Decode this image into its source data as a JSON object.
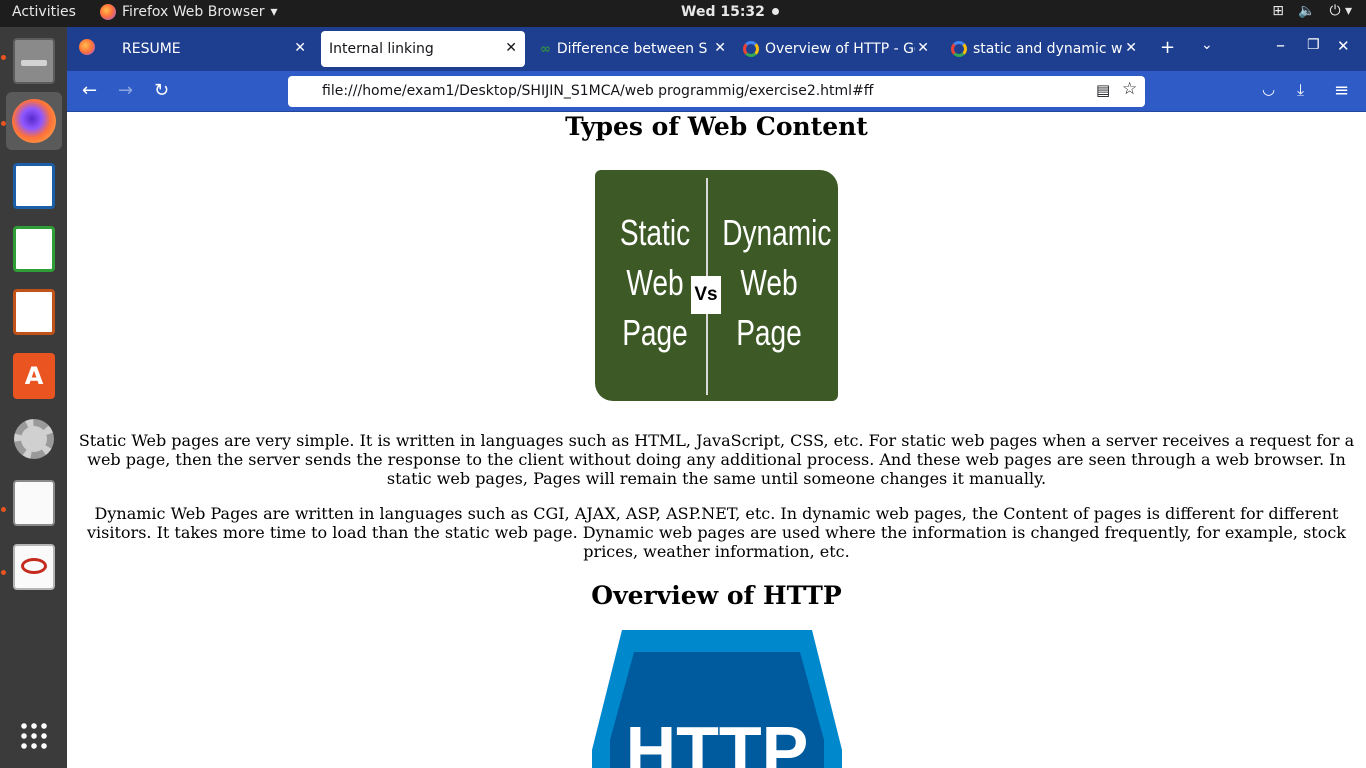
{
  "topbar": {
    "activities": "Activities",
    "app_name": "Firefox Web Browser",
    "clock": "Wed 15:32"
  },
  "tabs": [
    {
      "label": "RESUME",
      "icon": "firefox-icon",
      "selected": false
    },
    {
      "label": "Internal linking",
      "icon": "",
      "selected": true
    },
    {
      "label": "Difference between St",
      "icon": "geeksforgeeks-icon",
      "selected": false
    },
    {
      "label": "Overview of HTTP - Go",
      "icon": "google-icon",
      "selected": false
    },
    {
      "label": "static and dynamic web",
      "icon": "google-icon",
      "selected": false
    }
  ],
  "url": "file:///home/exam1/Desktop/SHIJIN_S1MCA/web programmig/exercise2.html#ff",
  "page": {
    "heading1": "Types of Web Content",
    "image1": {
      "left_lines": [
        "Static",
        "Web",
        "Page"
      ],
      "vs": "Vs",
      "right_lines": [
        "Dynamic",
        "Web",
        "Page"
      ]
    },
    "para1_lines": [
      "Static Web pages are very simple. It is written in languages such as HTML, JavaScript, CSS, etc. For static web pages when a server receives a request for a",
      "web page, then the server sends the response to the client without doing any additional process. And these web pages are seen through a web browser. In",
      "static web pages, Pages will remain the same until someone changes it manually."
    ],
    "para2_lines": [
      "Dynamic Web Pages are written in languages such as CGI, AJAX, ASP, ASP.NET, etc. In dynamic web pages, the Content of pages is different for different",
      "visitors. It takes more time to load than the static web page. Dynamic web pages are used where the information is changed frequently, for example, stock",
      "prices, weather information, etc."
    ],
    "heading2": "Overview of HTTP",
    "image2_text": "HTTP"
  },
  "colors": {
    "tabbar": "#1e3f8f",
    "navbar": "#2e5bc6",
    "image1_bg": "#3d5a26",
    "http_blue_light": "#0088cc",
    "http_blue_dark": "#005b9e"
  }
}
